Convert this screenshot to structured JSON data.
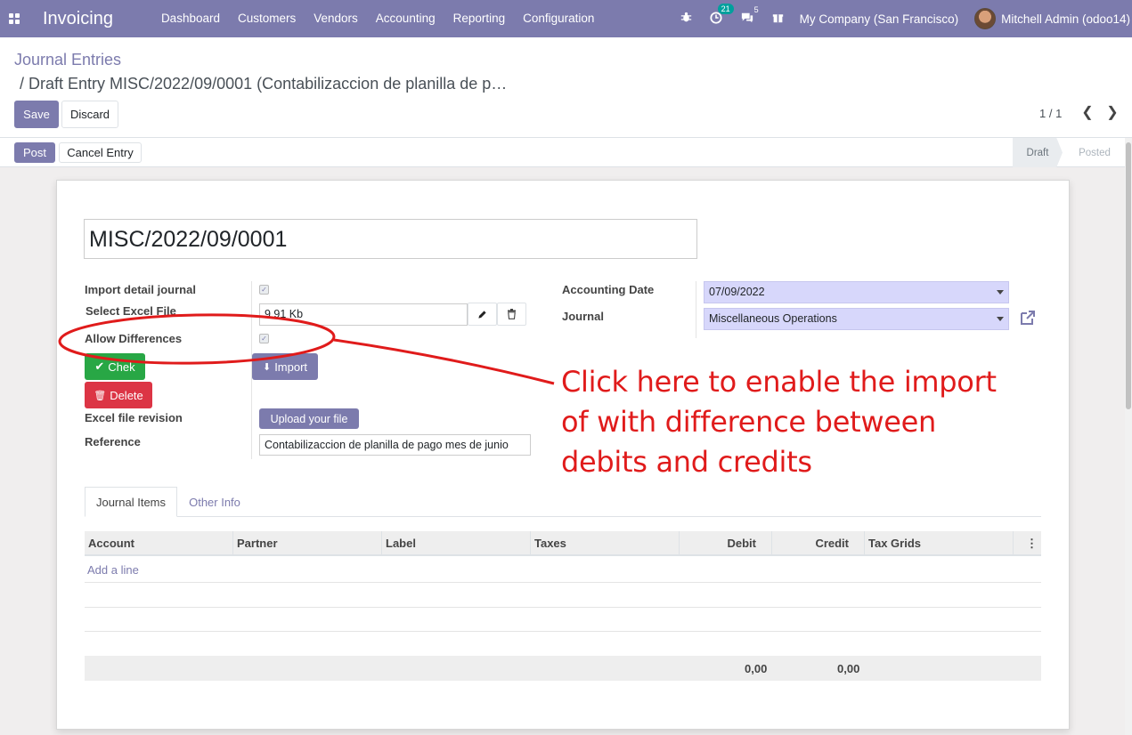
{
  "navbar": {
    "brand": "Invoicing",
    "menu": [
      "Dashboard",
      "Customers",
      "Vendors",
      "Accounting",
      "Reporting",
      "Configuration"
    ],
    "activity_count": "21",
    "messages_count": "5",
    "company": "My Company (San Francisco)",
    "user": "Mitchell Admin (odoo14)"
  },
  "breadcrumb": {
    "root": "Journal Entries",
    "current": "/ Draft Entry MISC/2022/09/0001 (Contabilizaccion de planilla de p…"
  },
  "actions": {
    "save": "Save",
    "discard": "Discard"
  },
  "pager": {
    "value": "1 / 1"
  },
  "statusbar": {
    "post": "Post",
    "cancel": "Cancel Entry",
    "stages": [
      "Draft",
      "Posted"
    ],
    "active_stage": "Draft"
  },
  "form": {
    "name": "MISC/2022/09/0001",
    "labels": {
      "import_detail": "Import detail journal",
      "select_file": "Select Excel File",
      "allow_diff": "Allow Differences",
      "revision": "Excel file revision",
      "reference": "Reference",
      "accounting_date": "Accounting Date",
      "journal": "Journal"
    },
    "file_size": "9.91 Kb",
    "buttons": {
      "chek": "Chek",
      "import": "Import",
      "delete": "Delete",
      "upload": "Upload your file"
    },
    "reference_value": "Contabilizaccion de planilla de pago mes de junio",
    "accounting_date_value": "07/09/2022",
    "journal_value": "Miscellaneous Operations",
    "import_detail_checked": true,
    "allow_diff_checked": true
  },
  "annotation": {
    "lines": [
      "Click here to enable the import",
      "of with difference between",
      "debits and credits"
    ],
    "color": "#e01b1b"
  },
  "tabs": [
    "Journal Items",
    "Other Info"
  ],
  "table": {
    "columns": [
      "Account",
      "Partner",
      "Label",
      "Taxes",
      "Debit",
      "Credit",
      "Tax Grids"
    ],
    "add_line": "Add a line",
    "total_debit": "0,00",
    "total_credit": "0,00"
  },
  "colors": {
    "primary": "#7c7bad",
    "success": "#28a745",
    "danger": "#dc3545"
  }
}
